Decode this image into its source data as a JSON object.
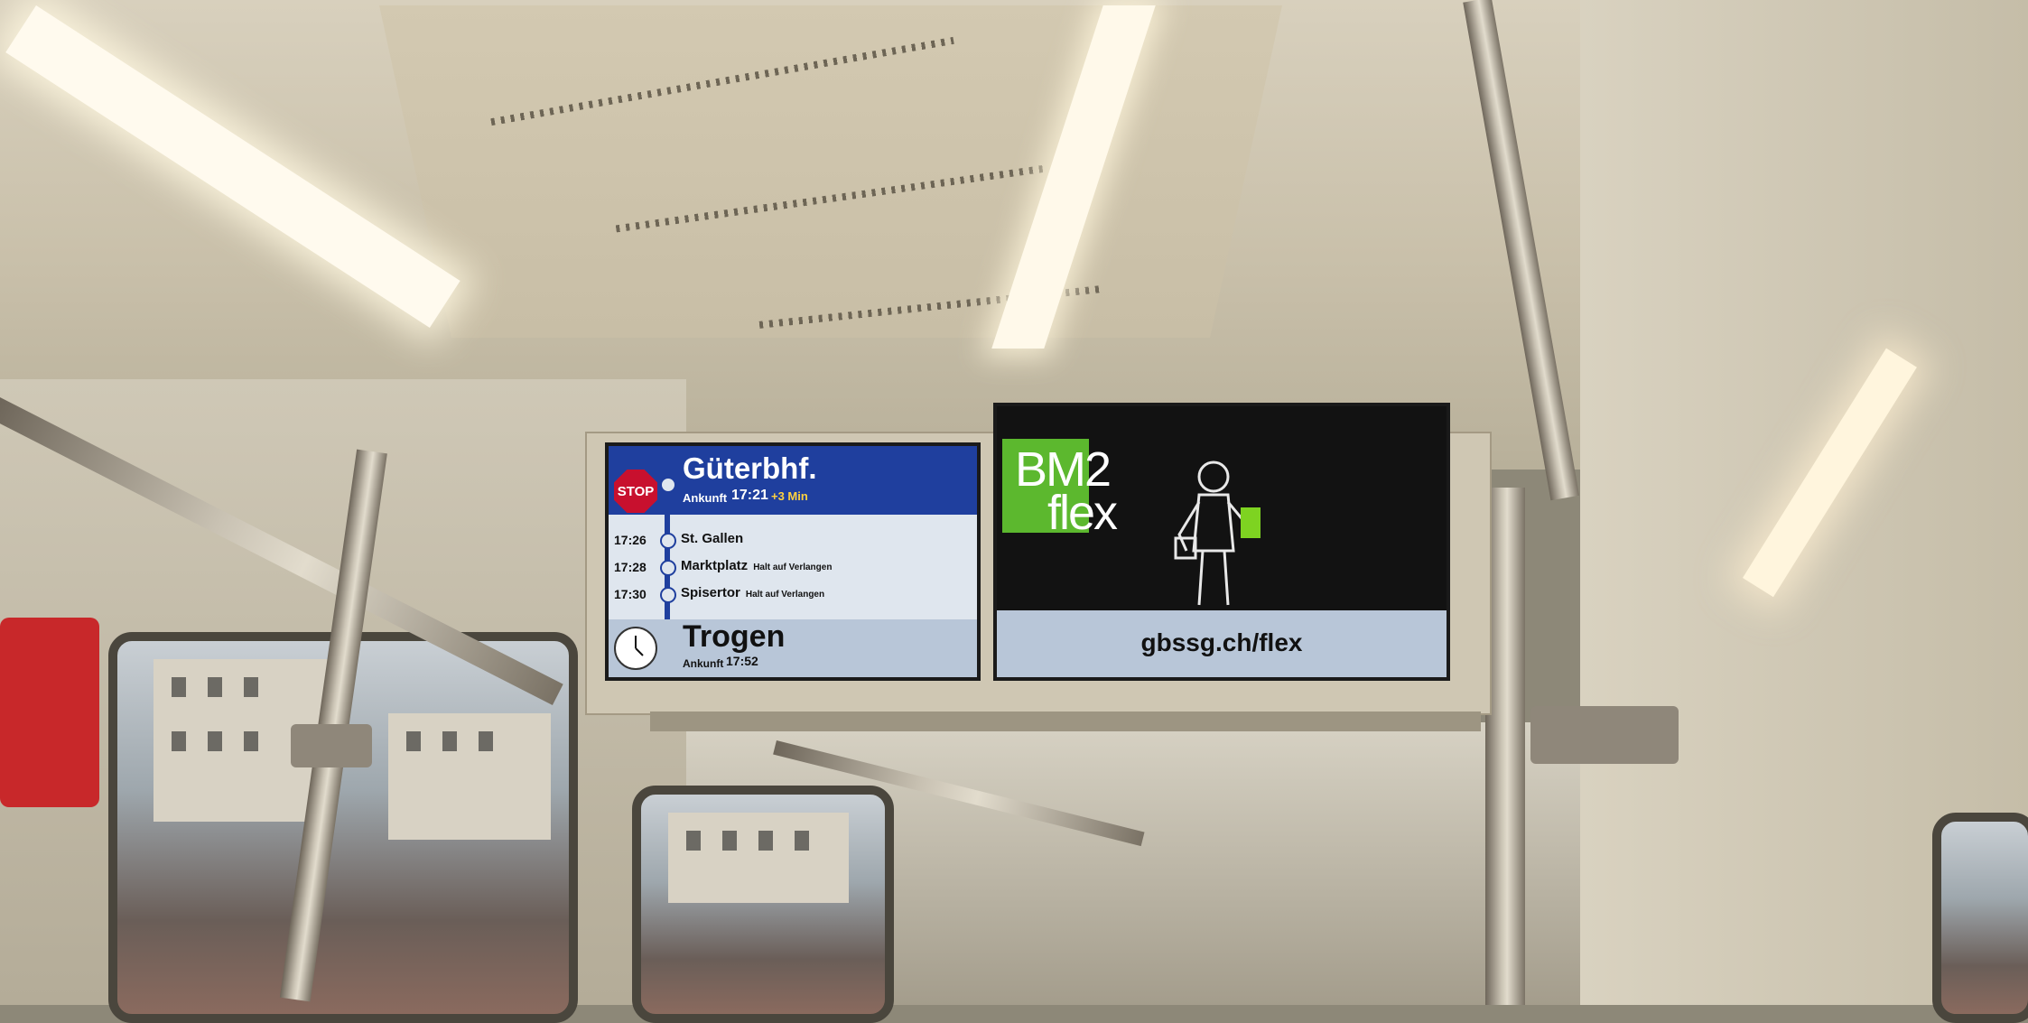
{
  "display": {
    "route_screen": {
      "stop_sign": "STOP",
      "next_stop": "Güterbhf.",
      "next_arrival_label": "Ankunft",
      "next_arrival_time": "17:21",
      "delay": "+3 Min",
      "stops": [
        {
          "time": "17:26",
          "name": "St. Gallen",
          "note": ""
        },
        {
          "time": "17:28",
          "name": "Marktplatz",
          "note": "Halt auf Verlangen"
        },
        {
          "time": "17:30",
          "name": "Spisertor",
          "note": "Halt auf Verlangen"
        }
      ],
      "final_destination": "Trogen",
      "final_arrival_label": "Ankunft",
      "final_arrival_time": "17:52",
      "line_color": "#1f3f9e"
    },
    "ad_screen": {
      "logo_line1": "BM2",
      "logo_line2": "flex",
      "url": "gbssg.ch/flex",
      "accent_color": "#5cb82e"
    }
  }
}
